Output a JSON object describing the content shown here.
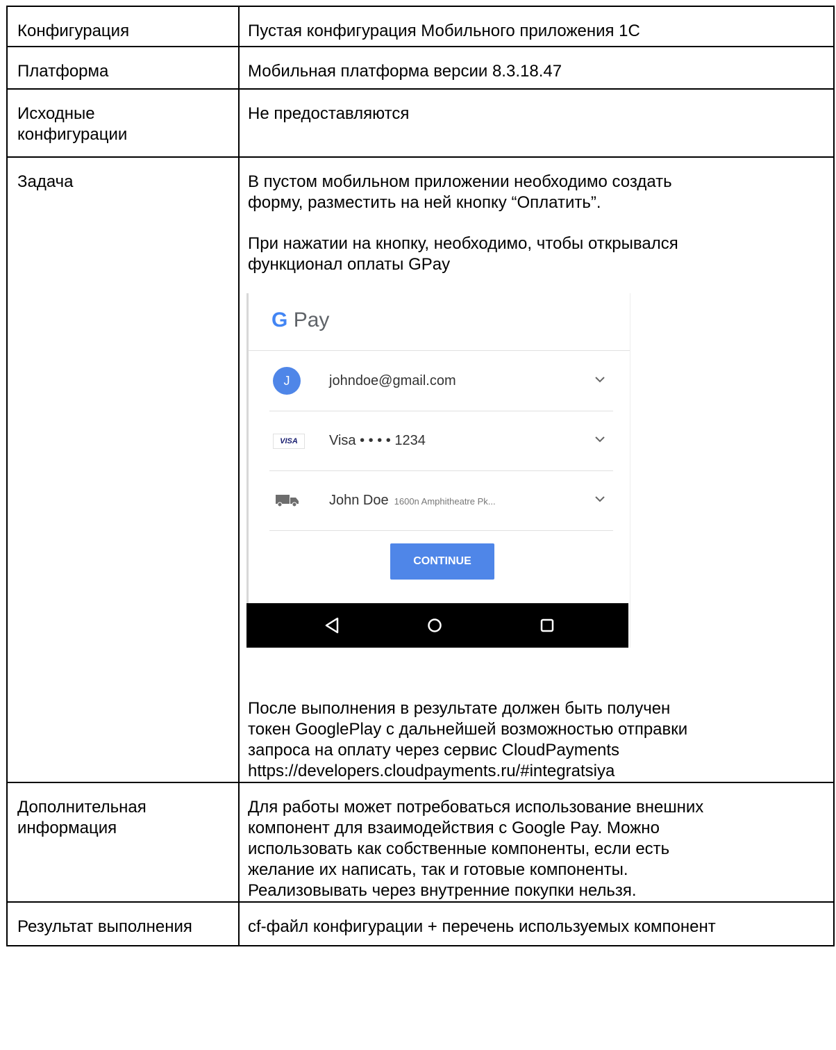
{
  "rows": [
    {
      "label": "Конфигурация",
      "value": "Пустая конфигурация Мобильного приложения 1С"
    },
    {
      "label": "Платформа",
      "value": "Мобильная платформа версии 8.3.18.47"
    },
    {
      "label": "Исходные\nконфигурации",
      "value": "Не предоставляются"
    },
    {
      "label": "Задача",
      "paragraphs": [
        "В пустом мобильном приложении необходимо создать\nформу, разместить на ней кнопку “Оплатить”.",
        "При нажатии на кнопку, необходимо, чтобы открывался\nфункционал оплаты GPay"
      ],
      "after": "После выполнения в результате должен быть получен\nтокен GooglePlay с дальнейшей возможностью отправки\nзапроса на оплату через сервис CloudPayments\nhttps://developers.cloudpayments.ru/#integratsiya"
    },
    {
      "label": "Дополнительная\nинформация",
      "value": "Для работы может потребоваться использование внешних\nкомпонент для взаимодействия с Google Pay. Можно\nиспользовать как собственные компоненты, если есть\nжелание их написать, так и готовые компоненты.\nРеализовывать через внутренние покупки нельзя."
    },
    {
      "label": "Результат выполнения",
      "value": "cf-файл конфигурации + перечень используемых компонент"
    }
  ],
  "gpay": {
    "logo_g": "G",
    "logo_text": "Pay",
    "avatar_letter": "J",
    "email": "johndoe@gmail.com",
    "card_brand": "VISA",
    "card": "Visa • • • • 1234",
    "name": "John Doe",
    "address": "1600n Amphitheatre Pk...",
    "continue": "CONTINUE",
    "colors": {
      "accent": "#4f86e8",
      "navbar": "#000000"
    }
  }
}
